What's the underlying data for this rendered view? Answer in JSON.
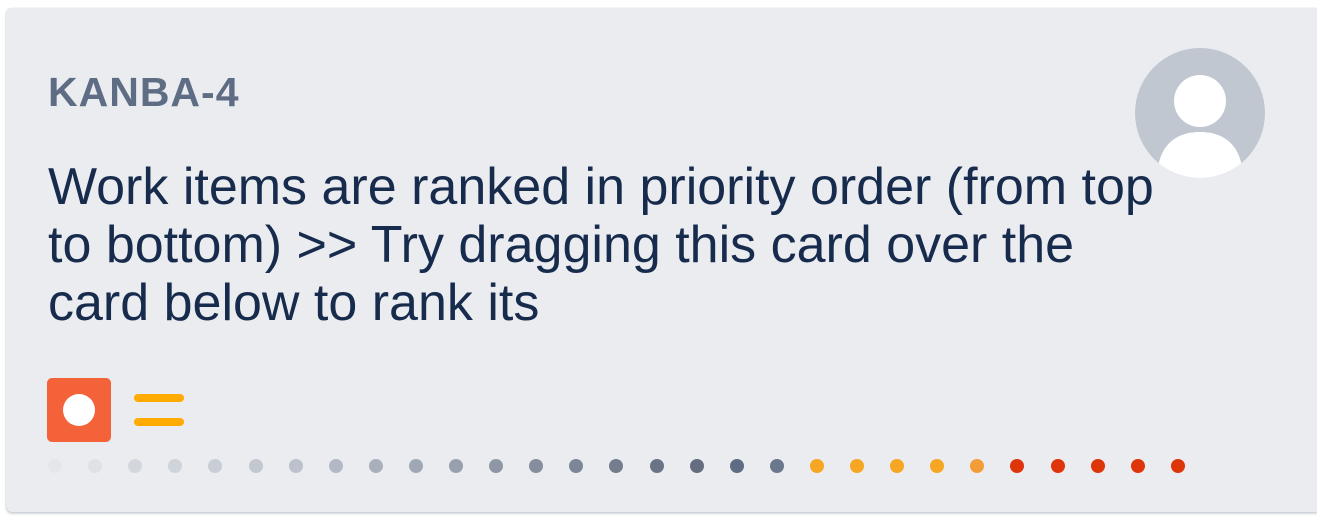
{
  "card": {
    "issue_key": "KANBA-4",
    "summary": "Work items are ranked in priority order (from top to bottom) >> Try dragging this card over the card below to rank its",
    "issue_type_icon": "story-circle-icon",
    "priority_icon": "priority-medium-icon",
    "avatar_icon": "unassigned-avatar-icon",
    "days_in_column": {
      "total_dots": 30,
      "colors": [
        "#e4e6ea",
        "#dfe1e6",
        "#d3d6dd",
        "#cfd3da",
        "#c9cdd5",
        "#c2c7d0",
        "#bcc1cb",
        "#b3b9c4",
        "#a9b0bc",
        "#a1a8b5",
        "#98a0ae",
        "#8f97a6",
        "#868e9e",
        "#7d8697",
        "#747d8e",
        "#6b7486",
        "#656e80",
        "#5e6c84",
        "#6b778c",
        "#f5a623",
        "#f5a623",
        "#f5a623",
        "#f5a623",
        "#f29d38",
        "#de350b",
        "#de350b",
        "#de350b",
        "#de350b",
        "#de350b"
      ]
    },
    "colors": {
      "card_background": "#ebecf0",
      "issue_key": "#5e6c84",
      "summary": "#172b4d",
      "issue_type": "#f4623a",
      "priority": "#ffab00"
    }
  }
}
